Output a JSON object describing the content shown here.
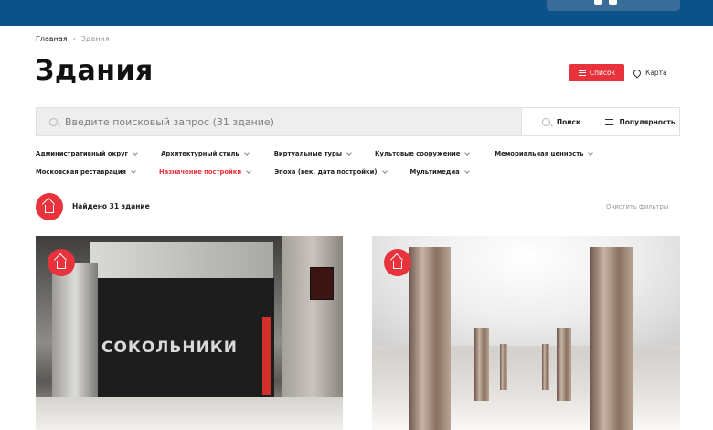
{
  "breadcrumb": {
    "home": "Главная",
    "separator": "›",
    "current": "Здания"
  },
  "page": {
    "title": "Здания"
  },
  "view_toggle": {
    "list_label": "Список",
    "map_label": "Карта"
  },
  "search": {
    "placeholder": "Введите поисковый запрос (31 здание)",
    "button_label": "Поиск",
    "sort_label": "Популярность"
  },
  "filters": {
    "row1": [
      {
        "label": "Административный округ",
        "active": false
      },
      {
        "label": "Архитектурный стиль",
        "active": false
      },
      {
        "label": "Виртуальные туры",
        "active": false
      },
      {
        "label": "Культовые сооружение",
        "active": false
      },
      {
        "label": "Мемориальная ценность",
        "active": false
      }
    ],
    "row2": [
      {
        "label": "Московская реставрация",
        "active": false
      },
      {
        "label": "Назначение постройки",
        "active": true
      },
      {
        "label": "Эпоха (век, дата постройки)",
        "active": false
      },
      {
        "label": "Мультимедиа",
        "active": false
      }
    ]
  },
  "results": {
    "found_text": "Найдено 31 здание",
    "clear_label": "Очистить фильтры"
  },
  "cards": [
    {
      "image_text": "СОКОЛЬНИКИ"
    },
    {
      "image_text": ""
    }
  ],
  "colors": {
    "header": "#0d5189",
    "accent": "#e8323c",
    "search_bg": "#eeeeee"
  },
  "icons": {
    "list": "hamburger-icon",
    "map": "map-pin-icon",
    "search": "search-icon",
    "sort": "sliders-icon",
    "filter_chevron": "chevron-down-icon",
    "building": "house-icon"
  }
}
